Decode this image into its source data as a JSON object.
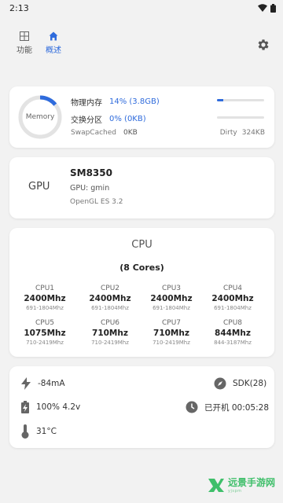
{
  "status_bar": {
    "time": "2:13"
  },
  "nav": {
    "tabs": [
      {
        "label": "功能",
        "icon": "grid-icon"
      },
      {
        "label": "概述",
        "icon": "home-icon",
        "active": true
      }
    ],
    "settings_icon": "gear-icon"
  },
  "memory": {
    "ring_label": "Memory",
    "ring_used_fraction": 0.14,
    "physical": {
      "label": "物理内存",
      "value": "14% (3.8GB)",
      "fraction": 0.14
    },
    "swap": {
      "label": "交换分区",
      "value": "0% (0KB)",
      "fraction": 0.0
    },
    "swap_cached": {
      "label": "SwapCached",
      "value": "0KB"
    },
    "dirty": {
      "label": "Dirty",
      "value": "324KB"
    }
  },
  "gpu": {
    "label": "GPU",
    "model": "SM8350",
    "name": "GPU: gmin",
    "opengl": "OpenGL ES 3.2"
  },
  "cpu": {
    "title": "CPU",
    "cores": "(8 Cores)",
    "cpus": [
      {
        "name": "CPU1",
        "freq": "2400Mhz",
        "range": "691-1804Mhz"
      },
      {
        "name": "CPU2",
        "freq": "2400Mhz",
        "range": "691-1804Mhz"
      },
      {
        "name": "CPU3",
        "freq": "2400Mhz",
        "range": "691-1804Mhz"
      },
      {
        "name": "CPU4",
        "freq": "2400Mhz",
        "range": "691-1804Mhz"
      },
      {
        "name": "CPU5",
        "freq": "1075Mhz",
        "range": "710-2419Mhz"
      },
      {
        "name": "CPU6",
        "freq": "710Mhz",
        "range": "710-2419Mhz"
      },
      {
        "name": "CPU7",
        "freq": "710Mhz",
        "range": "710-2419Mhz"
      },
      {
        "name": "CPU8",
        "freq": "844Mhz",
        "range": "844-3187Mhz"
      }
    ]
  },
  "system": {
    "current": "-84mA",
    "sdk": "SDK(28)",
    "battery": "100% 4.2v",
    "uptime": "已开机 00:05:28",
    "temperature": "31°C"
  },
  "watermark": {
    "text": "远景手游网",
    "sub": "yjspm"
  },
  "colors": {
    "accent": "#2f6bdc",
    "icon": "#666666",
    "watermark": "#3fbf6a"
  }
}
